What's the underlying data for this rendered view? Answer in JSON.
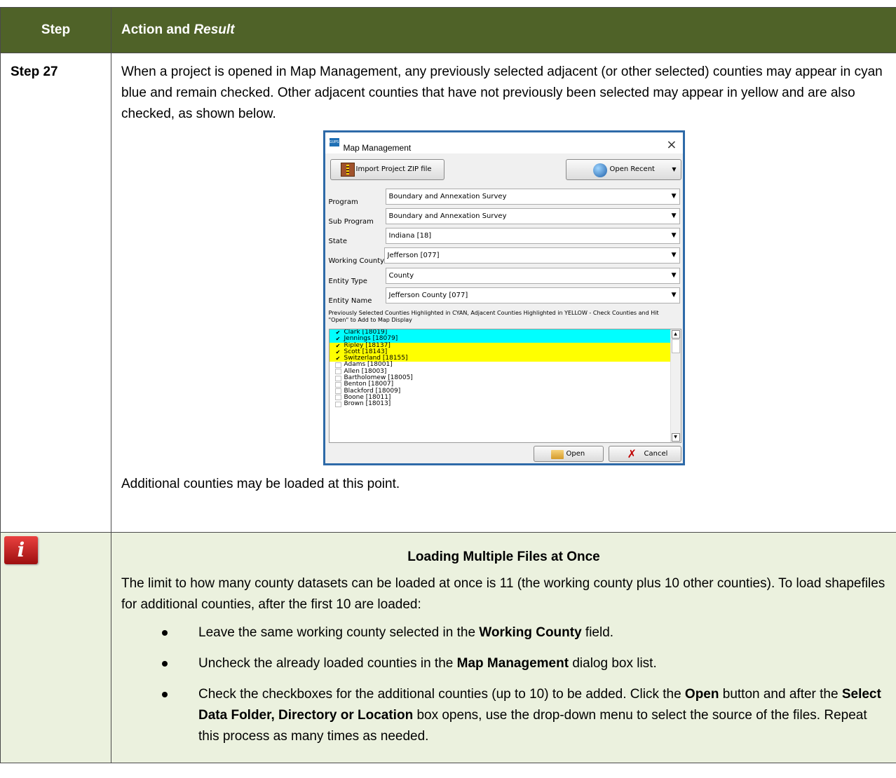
{
  "table": {
    "header_step": "Step",
    "header_action": "Action and ",
    "header_result": "Result"
  },
  "step27": {
    "label": "Step 27",
    "paragraph": "When a project is opened in Map Management, any previously selected adjacent (or other selected) counties may appear in cyan blue and remain checked. Other adjacent counties that have not previously been selected may appear in yellow and are also checked, as shown below.",
    "after": "Additional counties may be loaded at this point."
  },
  "dialog": {
    "app_icon": "GUPS",
    "title": "Map Management",
    "close": "×",
    "import_label": "Import Project ZIP file",
    "recent_label": "Open Recent",
    "fields": {
      "program_label": "Program",
      "program_value": "Boundary and Annexation Survey",
      "subprogram_label": "Sub Program",
      "subprogram_value": "Boundary and Annexation Survey",
      "state_label": "State",
      "state_value": "Indiana [18]",
      "working_label": "Working County",
      "working_value": "Jefferson [077]",
      "entitytype_label": "Entity Type",
      "entitytype_value": "County",
      "entityname_label": "Entity Name",
      "entityname_value": "Jefferson County [077]"
    },
    "list_caption": "Previously Selected Counties Highlighted in CYAN, Adjacent Counties Highlighted in YELLOW - Check Counties and Hit \"Open\" to Add to Map Display",
    "counties": [
      {
        "name": "Clark [18019]",
        "checked": true,
        "color": "#00ffff"
      },
      {
        "name": "Jennings [18079]",
        "checked": true,
        "color": "#00ffff"
      },
      {
        "name": "Ripley [18137]",
        "checked": true,
        "color": "#ffff00"
      },
      {
        "name": "Scott [18143]",
        "checked": true,
        "color": "#ffff00"
      },
      {
        "name": "Switzerland [18155]",
        "checked": true,
        "color": "#ffff00"
      },
      {
        "name": "Adams [18001]",
        "checked": false
      },
      {
        "name": "Allen [18003]",
        "checked": false
      },
      {
        "name": "Bartholomew [18005]",
        "checked": false
      },
      {
        "name": "Benton [18007]",
        "checked": false
      },
      {
        "name": "Blackford [18009]",
        "checked": false
      },
      {
        "name": "Boone [18011]",
        "checked": false
      },
      {
        "name": "Brown [18013]",
        "checked": false
      }
    ],
    "open_label": "Open",
    "cancel_label": "Cancel"
  },
  "note": {
    "title": "Loading Multiple Files at Once",
    "text": "The limit to how many county datasets can be loaded at once is 11 (the working county plus 10 other counties). To load shapefiles for additional counties, after the first 10 are loaded:",
    "b1_pre": "Leave the same working county selected in the ",
    "b1_bold": "Working County",
    "b1_post": " field.",
    "b2_pre": "Uncheck the already loaded counties in the ",
    "b2_bold": "Map Management",
    "b2_post": " dialog box list.",
    "b3_pre": "Check the checkboxes for the additional counties (up to 10) to be added. Click the ",
    "b3_bold1": "Open",
    "b3_mid": " button and after the ",
    "b3_bold2": "Select Data Folder, Directory or Location",
    "b3_post": " box opens, use the drop-down menu to select the source of the files. Repeat this process as many times as needed."
  },
  "colors": {
    "header_bg": "#4f6228",
    "note_bg": "#ebf1de",
    "cyan": "#00ffff",
    "yellow": "#ffff00"
  }
}
